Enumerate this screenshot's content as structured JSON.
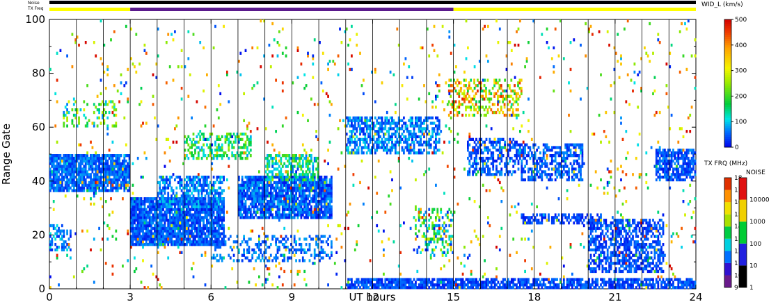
{
  "chart_data": {
    "type": "heatmap",
    "xlabel": "UT hours",
    "ylabel": "Range Gate",
    "xlim": [
      0,
      24
    ],
    "ylim": [
      0,
      100
    ],
    "x_ticks": [
      "0",
      "3",
      "6",
      "9",
      "12",
      "15",
      "18",
      "21",
      "24"
    ],
    "y_ticks": [
      "0",
      "20",
      "40",
      "60",
      "80",
      "100"
    ],
    "top_bars": {
      "noise_label": "Noise",
      "txfreq_label": "TX Freq",
      "txfreq_segments": [
        {
          "start": 0,
          "end": 3,
          "color": "#ffff00"
        },
        {
          "start": 3,
          "end": 15,
          "color": "#5a1a8c"
        },
        {
          "start": 15,
          "end": 24,
          "color": "#ffff00"
        }
      ]
    },
    "colorbar_width": {
      "title": "WID_L (km/s)",
      "ticks": [
        "0",
        "100",
        "200",
        "300",
        "400",
        "500"
      ],
      "range": [
        0,
        500
      ]
    },
    "colorbar_txfreq": {
      "title": "TX FRQ (MHz)",
      "ticks": [
        "9",
        "10",
        "11",
        "12",
        "13",
        "14",
        "15",
        "16",
        "17",
        "18"
      ]
    },
    "colorbar_noise": {
      "title": "NOISE",
      "ticks": [
        "1",
        "10",
        "100",
        "1000",
        "10000"
      ]
    },
    "blobs": [
      {
        "x0": 0.0,
        "x1": 3.0,
        "g0": 36,
        "g1": 50,
        "density": 0.85,
        "w": [
          20,
          90
        ]
      },
      {
        "x0": 0.5,
        "x1": 2.5,
        "g0": 60,
        "g1": 70,
        "density": 0.25,
        "w": [
          60,
          300
        ]
      },
      {
        "x0": 0.0,
        "x1": 0.8,
        "g0": 14,
        "g1": 24,
        "density": 0.5,
        "w": [
          20,
          120
        ]
      },
      {
        "x0": 3.0,
        "x1": 6.5,
        "g0": 16,
        "g1": 34,
        "density": 0.9,
        "w": [
          10,
          80
        ]
      },
      {
        "x0": 4.0,
        "x1": 6.5,
        "g0": 30,
        "g1": 42,
        "density": 0.6,
        "w": [
          20,
          110
        ]
      },
      {
        "x0": 5.0,
        "x1": 7.5,
        "g0": 48,
        "g1": 58,
        "density": 0.45,
        "w": [
          80,
          260
        ]
      },
      {
        "x0": 7.0,
        "x1": 10.5,
        "g0": 26,
        "g1": 42,
        "density": 0.85,
        "w": [
          10,
          90
        ]
      },
      {
        "x0": 8.0,
        "x1": 10.0,
        "g0": 40,
        "g1": 50,
        "density": 0.5,
        "w": [
          60,
          240
        ]
      },
      {
        "x0": 6.0,
        "x1": 10.5,
        "g0": 10,
        "g1": 20,
        "density": 0.35,
        "w": [
          20,
          90
        ]
      },
      {
        "x0": 11.0,
        "x1": 14.5,
        "g0": 50,
        "g1": 64,
        "density": 0.6,
        "w": [
          20,
          110
        ]
      },
      {
        "x0": 11.0,
        "x1": 15.0,
        "g0": 0,
        "g1": 4,
        "density": 0.85,
        "w": [
          10,
          70
        ]
      },
      {
        "x0": 15.0,
        "x1": 24.0,
        "g0": 0,
        "g1": 4,
        "density": 0.75,
        "w": [
          10,
          70
        ]
      },
      {
        "x0": 14.8,
        "x1": 17.5,
        "g0": 64,
        "g1": 78,
        "density": 0.35,
        "w": [
          150,
          480
        ]
      },
      {
        "x0": 15.5,
        "x1": 17.5,
        "g0": 42,
        "g1": 56,
        "density": 0.5,
        "w": [
          10,
          80
        ]
      },
      {
        "x0": 17.5,
        "x1": 19.8,
        "g0": 40,
        "g1": 54,
        "density": 0.55,
        "w": [
          10,
          80
        ]
      },
      {
        "x0": 17.5,
        "x1": 20.5,
        "g0": 24,
        "g1": 28,
        "density": 0.6,
        "w": [
          10,
          60
        ]
      },
      {
        "x0": 20.0,
        "x1": 22.8,
        "g0": 6,
        "g1": 26,
        "density": 0.6,
        "w": [
          10,
          70
        ]
      },
      {
        "x0": 22.5,
        "x1": 24.0,
        "g0": 40,
        "g1": 52,
        "density": 0.75,
        "w": [
          10,
          80
        ]
      },
      {
        "x0": 13.5,
        "x1": 15.0,
        "g0": 12,
        "g1": 30,
        "density": 0.3,
        "w": [
          10,
          300
        ]
      },
      {
        "x0": 0.0,
        "x1": 24.0,
        "g0": 0,
        "g1": 100,
        "density": 0.025,
        "w": [
          0,
          500
        ]
      }
    ]
  }
}
